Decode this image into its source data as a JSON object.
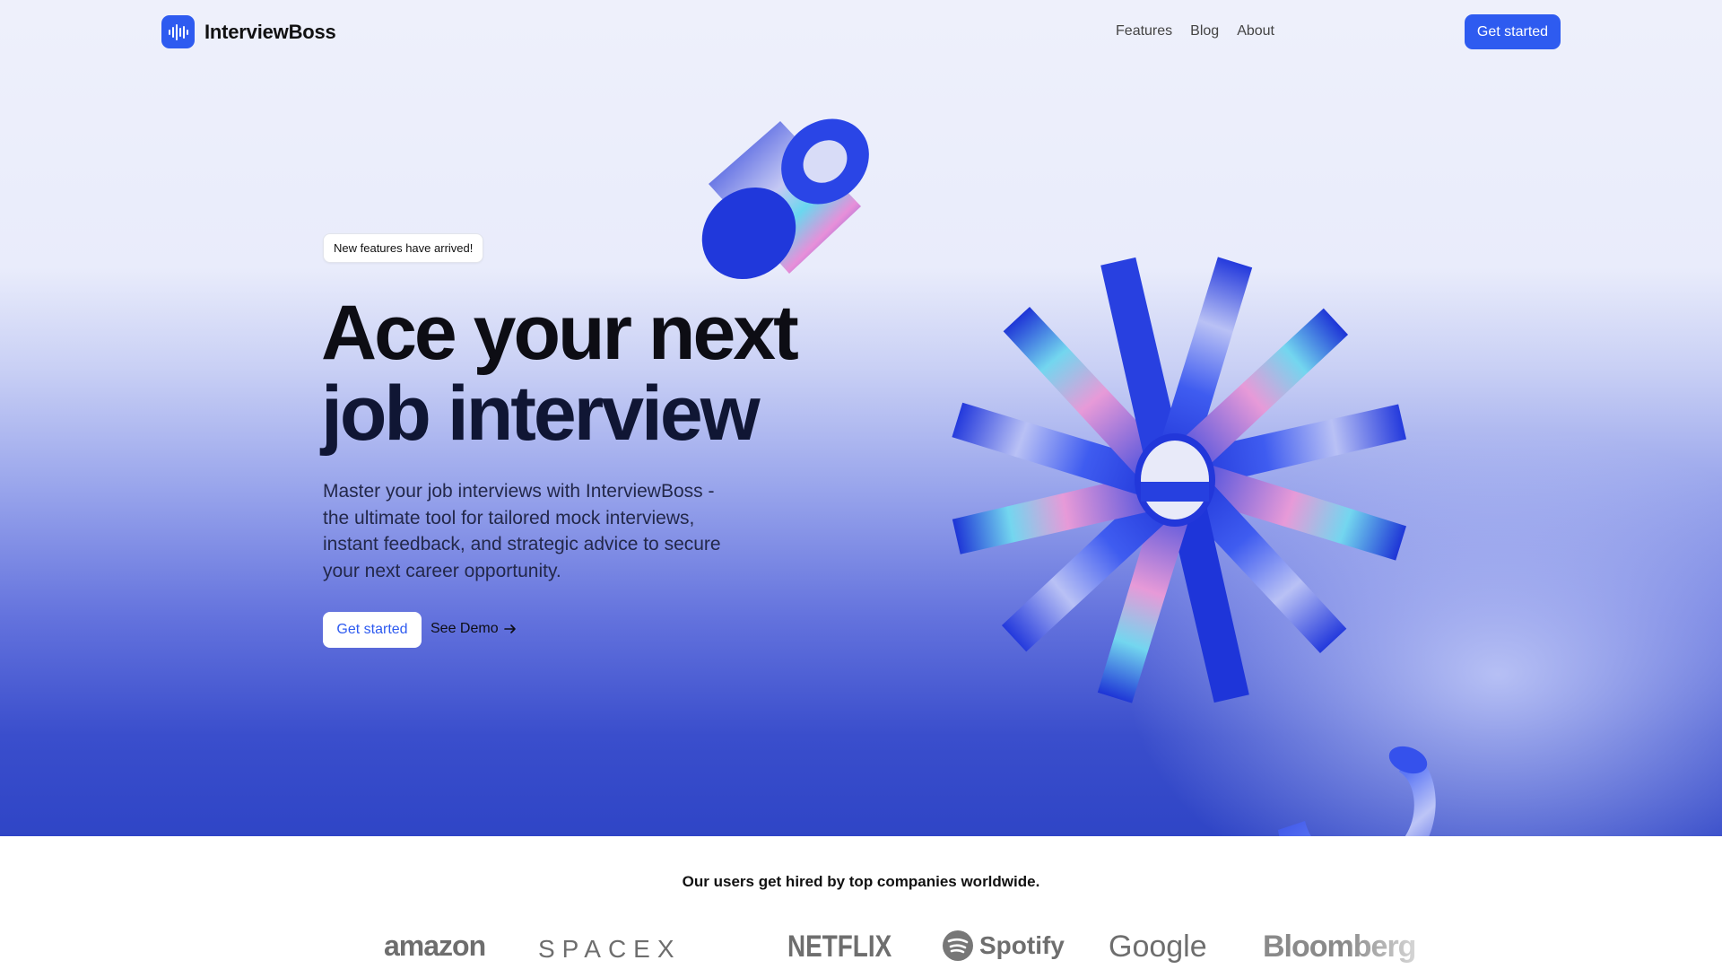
{
  "brand": {
    "name": "InterviewBoss",
    "accent": "#2e5bf0"
  },
  "nav": {
    "links": [
      "Features",
      "Blog",
      "About"
    ],
    "cta": "Get started"
  },
  "hero": {
    "badge": "New features have arrived!",
    "headline_line1": "Ace your next",
    "headline_line2": "job interview",
    "subtext": "Master your job interviews with InterviewBoss - the ultimate tool for tailored mock interviews, instant feedback, and strategic advice to secure your next career opportunity.",
    "primary_cta": "Get started",
    "secondary_cta": "See Demo",
    "secondary_icon": "arrow-right-icon"
  },
  "companies": {
    "tagline": "Our users get hired by top companies worldwide.",
    "logos": [
      "amazon",
      "SPACEX",
      "NETFLIX",
      "Spotify",
      "Google",
      "Bloomberg"
    ]
  }
}
